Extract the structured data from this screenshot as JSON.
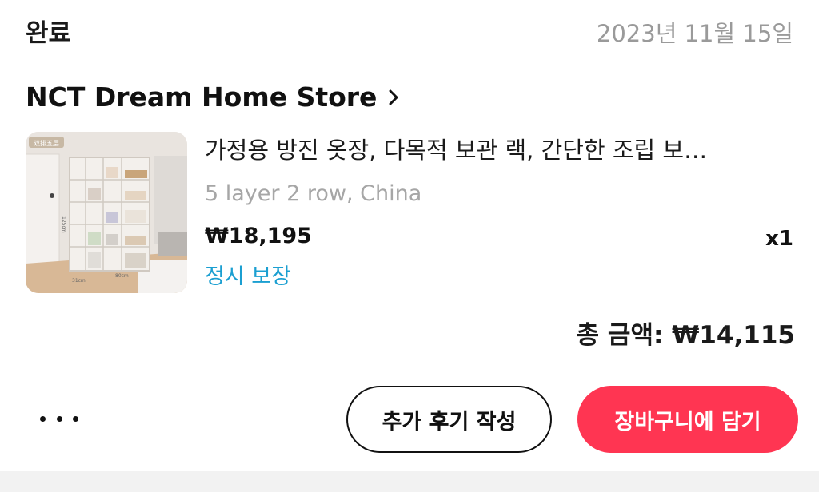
{
  "order": {
    "status": "완료",
    "date": "2023년 11월 15일"
  },
  "store": {
    "name": "NCT Dream Home Store",
    "chevron_icon": "chevron-right-icon"
  },
  "product": {
    "title": "가정용 방진 옷장, 다목적 보관 랙, 간단한 조립 보…",
    "option": "5 layer 2 row, China",
    "price": "₩18,195",
    "quantity": "x1",
    "guarantee": "정시 보장",
    "image_label": "双排五层",
    "image_dim_height": "125cm",
    "image_dim_depth": "31cm",
    "image_dim_width": "80cm"
  },
  "summary": {
    "total": "총 금액: ₩14,115"
  },
  "actions": {
    "more_icon": "more-horizontal-icon",
    "review_label": "추가 후기 작성",
    "cart_label": "장바구니에 담기"
  },
  "colors": {
    "accent": "#ff3552",
    "guarantee": "#1b9fd1",
    "muted": "#9a9a9a"
  }
}
